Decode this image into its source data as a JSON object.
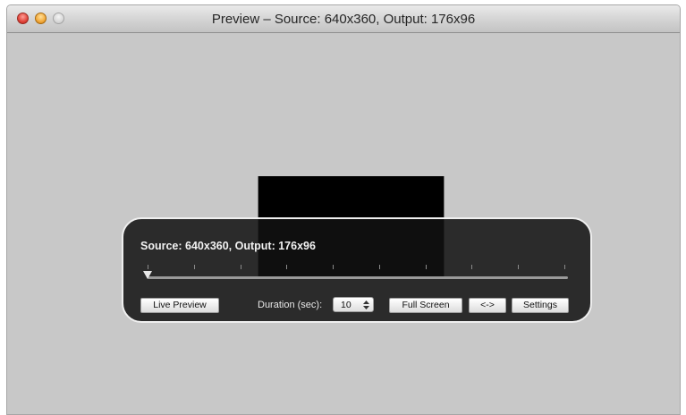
{
  "window": {
    "title": "Preview – Source: 640x360, Output: 176x96"
  },
  "hud": {
    "status": "Source: 640x360, Output: 176x96",
    "slider": {
      "position": 0,
      "tick_count": 10
    },
    "live_preview_label": "Live Preview",
    "duration_label": "Duration (sec):",
    "duration_value": "10",
    "full_screen_label": "Full Screen",
    "swap_label": "<->",
    "settings_label": "Settings"
  },
  "colors": {
    "window_background": "#c8c8c8",
    "hud_background": "#121212",
    "hud_border": "#efefef",
    "video_frame": "#000000"
  },
  "icons": {
    "close": "close-icon",
    "minimize": "minimize-icon",
    "zoom": "zoom-icon",
    "stepper": "stepper-icon"
  }
}
